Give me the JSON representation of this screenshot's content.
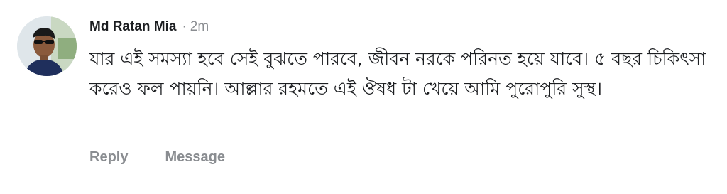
{
  "comment": {
    "author": "Md Ratan Mia",
    "separator": "·",
    "timestamp": "2m",
    "text": "যার এই সমস্যা হবে সেই বুঝতে পারবে, জীবন নরকে পরিনত হয়ে যাবে। ৫ বছর চিকিৎসা করেও ফল পায়নি। আল্লার রহমতে এই ঔষধ টা খেয়ে আমি পুরোপুরি সুস্থ।",
    "avatar_icon": "profile-photo"
  },
  "actions": {
    "reply_label": "Reply",
    "message_label": "Message"
  },
  "colors": {
    "text": "#1c1e21",
    "secondary": "#8a8d91"
  }
}
